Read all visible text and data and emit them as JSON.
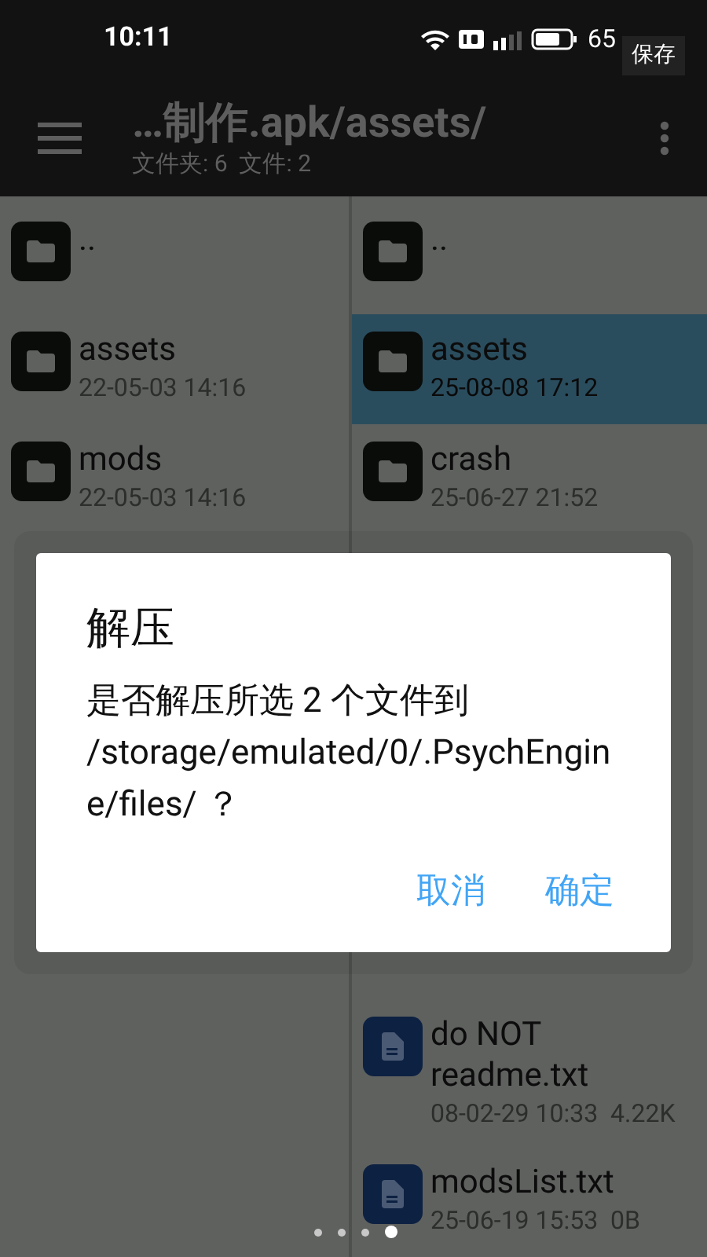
{
  "status_bar": {
    "time": "10:11",
    "battery": "65"
  },
  "tooltip": "保存",
  "toolbar": {
    "title": "…制作.apk/assets/",
    "subtitle": "文件夹: 6  文件: 2"
  },
  "left_pane": {
    "items": [
      {
        "kind": "folder",
        "name": "..",
        "selected": false
      },
      {
        "kind": "folder",
        "name": "assets",
        "meta": "22-05-03 14:16",
        "selected": false
      },
      {
        "kind": "folder",
        "name": "mods",
        "meta": "22-05-03 14:16",
        "selected": false
      }
    ]
  },
  "right_pane": {
    "items": [
      {
        "kind": "folder",
        "name": "..",
        "selected": false
      },
      {
        "kind": "folder",
        "name": "assets",
        "meta": "25-08-08 17:12",
        "selected": true
      },
      {
        "kind": "folder",
        "name": "crash",
        "meta": "25-06-27 21:52",
        "selected": false
      }
    ],
    "bottom_items": [
      {
        "kind": "file",
        "name": "do NOT readme.txt",
        "meta": "08-02-29 10:33  4.22K",
        "selected": false
      },
      {
        "kind": "file",
        "name": "modsList.txt",
        "meta": "25-06-19 15:53  0B",
        "selected": false
      }
    ]
  },
  "page_dots": [
    {
      "selected": false
    },
    {
      "selected": false
    },
    {
      "selected": false
    },
    {
      "selected": true
    }
  ],
  "dialog": {
    "title": "解压",
    "message": "是否解压所选 2 个文件到 /storage/emulated/0/.PsychEngine/files/ ？",
    "buttons": [
      "取消",
      "确定"
    ]
  }
}
